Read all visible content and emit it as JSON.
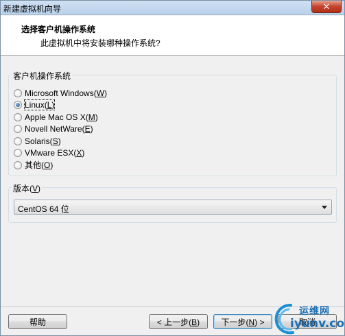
{
  "window": {
    "title": "新建虚拟机向导",
    "close_glyph": "✕"
  },
  "header": {
    "title": "选择客户机操作系统",
    "subtitle": "此虚拟机中将安装哪种操作系统?"
  },
  "os_group": {
    "label": "客户机操作系统",
    "options": [
      {
        "name": "Microsoft Windows(",
        "key": "W",
        "end": ")",
        "checked": false
      },
      {
        "name": "Linux(",
        "key": "L",
        "end": ")",
        "checked": true
      },
      {
        "name": "Apple Mac OS X(",
        "key": "M",
        "end": ")",
        "checked": false
      },
      {
        "name": "Novell NetWare(",
        "key": "E",
        "end": ")",
        "checked": false
      },
      {
        "name": "Solaris(",
        "key": "S",
        "end": ")",
        "checked": false
      },
      {
        "name": "VMware ESX(",
        "key": "X",
        "end": ")",
        "checked": false
      },
      {
        "name": "其他(",
        "key": "O",
        "end": ")",
        "checked": false
      }
    ]
  },
  "version_group": {
    "label_prefix": "版本(",
    "label_key": "V",
    "label_suffix": ")",
    "selected": "CentOS 64 位"
  },
  "footer": {
    "help": "帮助",
    "back_prefix": "< 上一步(",
    "back_key": "B",
    "back_suffix": ")",
    "next_prefix": "下一步(",
    "next_key": "N",
    "next_suffix": ") >",
    "cancel": "取消"
  },
  "watermark": {
    "line1": "运维网",
    "line2": "iyunv.com"
  }
}
